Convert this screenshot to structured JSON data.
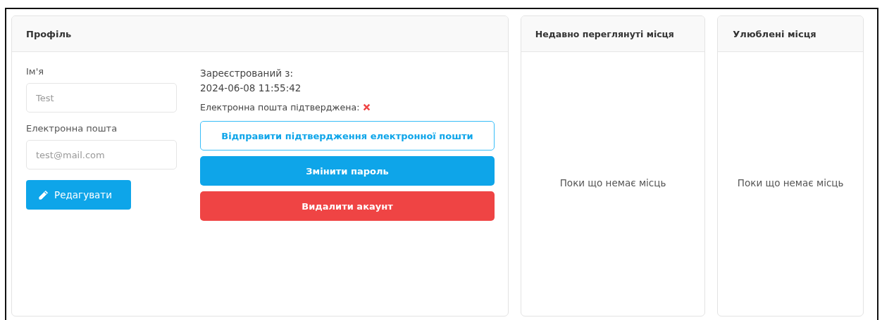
{
  "profile": {
    "title": "Профіль",
    "fields": [
      {
        "label": "Ім'я",
        "value": "Test",
        "disabled": true
      },
      {
        "label": "Електронна пошта",
        "value": "test@mail.com",
        "disabled": true
      }
    ],
    "edit_button": "Редагувати",
    "registered_label": "Зареєстрований з:",
    "registered_at": "2024-06-08 11:55:42",
    "email_verified_label": "Електронна пошта підтверджена:",
    "email_verified": false,
    "actions": [
      {
        "label": "Відправити підтвердження електронної пошти",
        "kind": "outline"
      },
      {
        "label": "Змінити пароль",
        "kind": "primary"
      },
      {
        "label": "Видалити акаунт",
        "kind": "danger"
      }
    ]
  },
  "panels": [
    {
      "title": "Недавно переглянуті місця",
      "empty_text": "Поки що немає місць"
    },
    {
      "title": "Улюблені місця",
      "empty_text": "Поки що немає місць"
    }
  ]
}
